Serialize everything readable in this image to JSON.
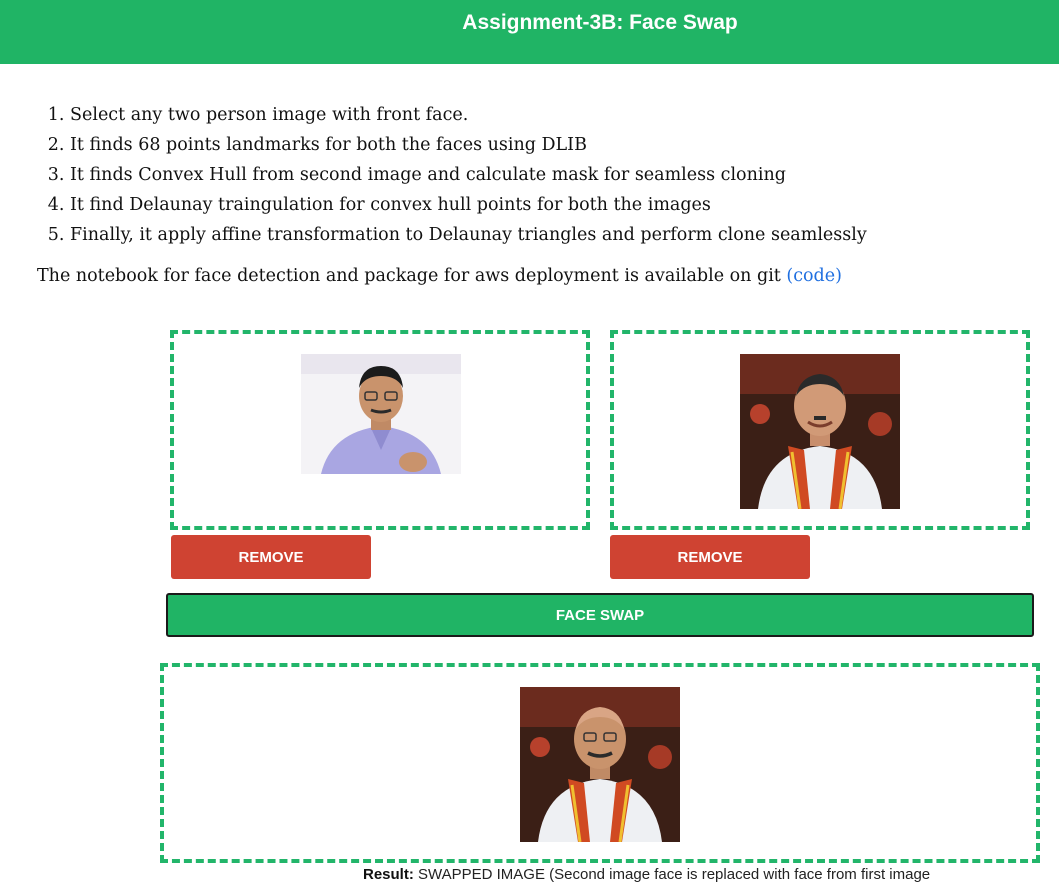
{
  "header": {
    "title": "Assignment-3B: Face Swap"
  },
  "steps": [
    "Select any two person image with front face.",
    "It finds 68 points landmarks for both the faces using DLIB",
    "It finds Convex Hull from second image and calculate mask for seamless cloning",
    "It find Delaunay traingulation for convex hull points for both the images",
    "Finally, it apply affine transformation to Delaunay triangles and perform clone seamlessly"
  ],
  "note": {
    "text": "The notebook for face detection and package for aws deployment is available on git ",
    "link_open": "(",
    "link_label": "code",
    "link_close": ")"
  },
  "uploads": {
    "remove_label_1": "REMOVE",
    "remove_label_2": "REMOVE"
  },
  "face_swap_label": "FACE SWAP",
  "result": {
    "caption_bold": "Result:",
    "caption_text": " SWAPPED IMAGE (Second image face is replaced with face from first image"
  },
  "colors": {
    "header_bg": "#20b465",
    "remove_btn": "#cf4332",
    "swap_btn": "#20b465",
    "dropzone_border": "#22b56a",
    "link": "#1f6fe0"
  },
  "icons": [
    "person-photo-1",
    "person-photo-2",
    "swapped-photo"
  ]
}
